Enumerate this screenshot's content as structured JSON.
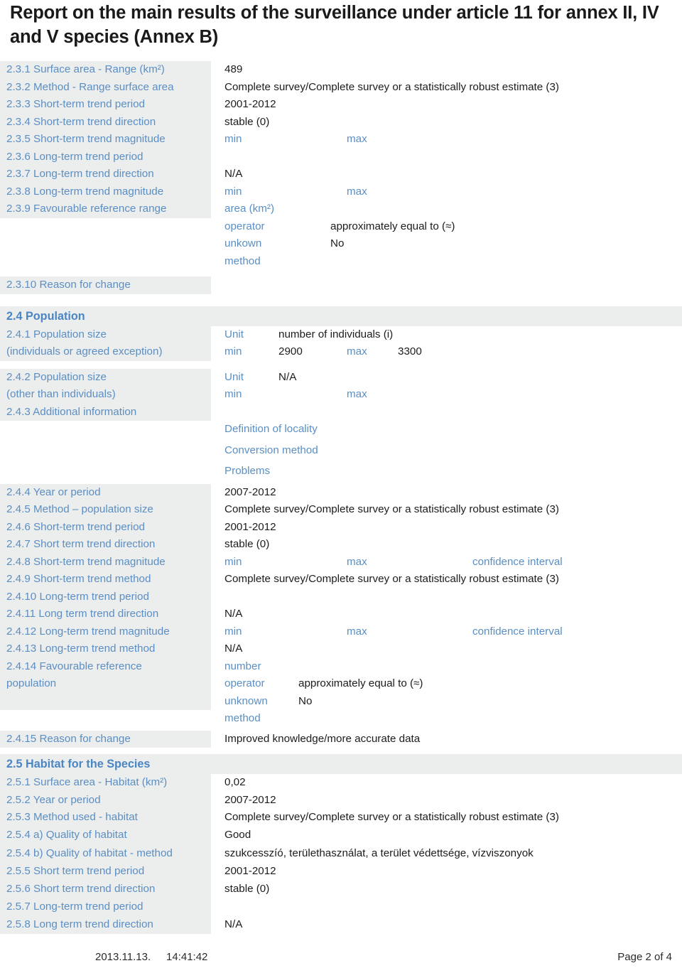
{
  "title": "Report on the main results of the surveillance under article 11 for annex II, IV and V species (Annex B)",
  "labels": {
    "min": "min",
    "max": "max",
    "unit": "Unit",
    "area": "area  (km²)",
    "operator": "operator",
    "unkown": "unkown",
    "unknown": "unknown",
    "method": "method",
    "number": "number",
    "confidence_interval": "confidence interval",
    "definition_of_locality": "Definition of locality",
    "conversion_method": "Conversion method",
    "problems": "Problems"
  },
  "rows": {
    "r231_label": "2.3.1 Surface area - Range  (km²)",
    "r231_value": "489",
    "r232_label": "2.3.2 Method - Range surface area",
    "r232_value": "Complete survey/Complete survey or a statistically robust estimate (3)",
    "r233_label": "2.3.3 Short-term trend period",
    "r233_value": "2001-2012",
    "r234_label": "2.3.4 Short-term trend direction",
    "r234_value": "stable (0)",
    "r235_label": "2.3.5 Short-term trend magnitude",
    "r236_label": "2.3.6 Long-term trend period",
    "r236_value": "",
    "r237_label": "2.3.7 Long-term trend direction",
    "r237_value": "N/A",
    "r238_label": "2.3.8 Long-term trend magnitude",
    "r239_label": "2.3.9 Favourable reference range",
    "r239_operator_value": "approximately equal to (≈)",
    "r239_unkown_value": "No",
    "r2310_label": "2.3.10 Reason for change",
    "r2310_value": ""
  },
  "section_population": {
    "heading": "2.4 Population",
    "r241_label_line1": "2.4.1 Population size",
    "r241_label_line2": "(individuals or agreed exception)",
    "r241_unit_value": "number of individuals (i)",
    "r241_min_value": "2900",
    "r241_max_value": "3300",
    "r242_label_line1": "2.4.2 Population size",
    "r242_label_line2": "(other than individuals)",
    "r242_unit_value": "N/A",
    "r243_label": "2.4.3 Additional information",
    "r244_label": "2.4.4 Year or period",
    "r244_value": "2007-2012",
    "r245_label": "2.4.5 Method – population size",
    "r245_value": "Complete survey/Complete survey or a statistically robust estimate (3)",
    "r246_label": "2.4.6 Short-term trend period",
    "r246_value": "2001-2012",
    "r247_label": "2.4.7 Short term trend direction",
    "r247_value": "stable (0)",
    "r248_label": "2.4.8 Short-term trend magnitude",
    "r249_label": "2.4.9 Short-term trend method",
    "r249_value": "Complete survey/Complete survey or a statistically robust estimate (3)",
    "r2410_label": "2.4.10 Long-term trend period",
    "r2410_value": "",
    "r2411_label": "2.4.11 Long term trend direction",
    "r2411_value": "N/A",
    "r2412_label": "2.4.12 Long-term trend magnitude",
    "r2413_label": "2.4.13 Long-term trend method",
    "r2413_value": "N/A",
    "r2414_label_line1": "2.4.14 Favourable reference",
    "r2414_label_line2": "population",
    "r2414_operator_value": "approximately equal to (≈)",
    "r2414_unknown_value": "No",
    "r2415_label": "2.4.15 Reason for change",
    "r2415_value": "Improved knowledge/more accurate data"
  },
  "section_habitat": {
    "heading": "2.5 Habitat for the Species",
    "r251_label": "2.5.1 Surface area - Habitat (km²)",
    "r251_value": "0,02",
    "r252_label": "2.5.2 Year or period",
    "r252_value": "2007-2012",
    "r253_label": "2.5.3 Method used - habitat",
    "r253_value": "Complete survey/Complete survey or a statistically robust estimate (3)",
    "r254a_label": "2.5.4 a) Quality of habitat",
    "r254a_value": "Good",
    "r254b_label": "2.5.4 b) Quality of habitat - method",
    "r254b_value": "szukcesszíó, területhasználat, a terület védettsége, vízviszonyok",
    "r255_label": "2.5.5 Short term trend period",
    "r255_value": "2001-2012",
    "r256_label": "2.5.6 Short term trend direction",
    "r256_value": "stable (0)",
    "r257_label": "2.5.7 Long-term trend period",
    "r257_value": "",
    "r258_label": "2.5.8 Long term trend direction",
    "r258_value": "N/A"
  },
  "footer": {
    "date": "2013.11.13.",
    "time": "14:41:42",
    "page": "Page 2 of 4"
  },
  "colors": {
    "label_blue": "#5b8fc4",
    "heading_blue": "#4a85c4",
    "row_bg": "#eceded",
    "value_dark": "#1c1c1c"
  }
}
